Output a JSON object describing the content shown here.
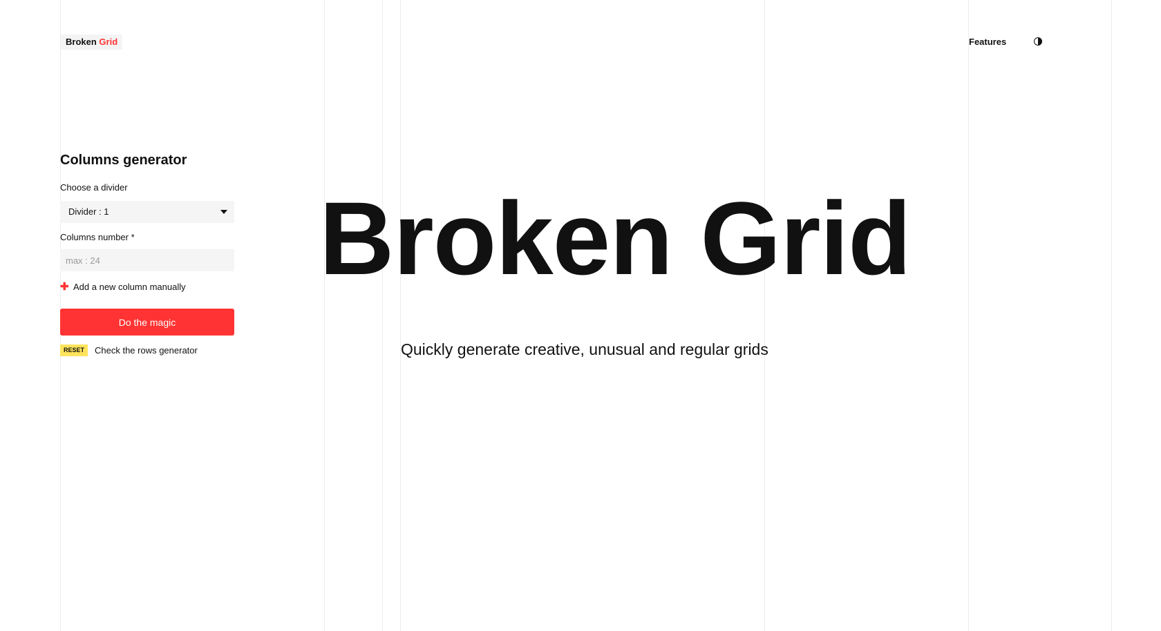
{
  "header": {
    "logo_part1": "Broken",
    "logo_part2": "Grid",
    "nav_features": "Features",
    "theme_icon": "contrast-icon"
  },
  "columns_panel": {
    "title": "Columns generator",
    "divider_label": "Choose a divider",
    "divider_value": "Divider : 1",
    "columns_label": "Columns number *",
    "columns_placeholder": "max : 24",
    "add_column_label": "Add a new column manually",
    "submit_label": "Do the magic",
    "reset_label": "RESET",
    "rows_link": "Check the rows generator"
  },
  "hero": {
    "title": "Broken Grid",
    "subtitle": "Quickly generate creative, unusual and regular grids"
  },
  "colors": {
    "accent": "#ff3333",
    "badge": "#ffe45c",
    "input_bg": "#f5f5f5",
    "grid_line": "#ececec"
  }
}
